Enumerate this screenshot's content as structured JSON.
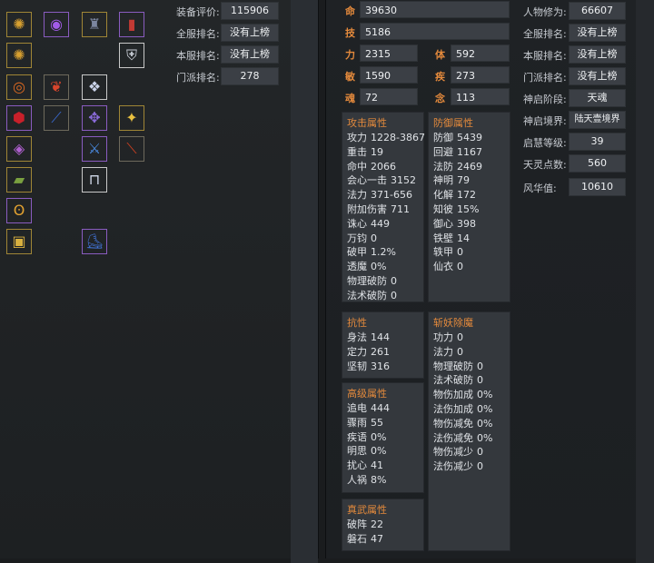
{
  "equipment": {
    "slots": [
      {
        "icon": "sun-medallion-icon",
        "glyph": "✺",
        "color": "#d8a030"
      },
      {
        "icon": "purple-orb-icon",
        "glyph": "◉",
        "color": "#a25be8"
      },
      {
        "icon": "dark-helm-icon",
        "glyph": "♜",
        "color": "#7c86a0"
      },
      {
        "icon": "red-gauntlet-icon",
        "glyph": "▮",
        "color": "#c23a34"
      },
      {
        "icon": "sun-medallion-icon",
        "glyph": "✺",
        "color": "#d8a030"
      },
      {
        "icon": "silver-armor-icon",
        "glyph": "⛨",
        "color": "#c8cdd6"
      },
      {
        "icon": "fire-ring-icon",
        "glyph": "◎",
        "color": "#e06a20"
      },
      {
        "icon": "red-feather-icon",
        "glyph": "❦",
        "color": "#d8452c"
      },
      {
        "icon": "crystal-armor-icon",
        "glyph": "❖",
        "color": "#c9d2e8"
      },
      {
        "icon": "red-bracer-icon",
        "glyph": "⬢",
        "color": "#c8202a"
      },
      {
        "icon": "blue-blade-icon",
        "glyph": "⟋",
        "color": "#3a6ad0"
      },
      {
        "icon": "violet-robe-icon",
        "glyph": "✥",
        "color": "#8a6ad8"
      },
      {
        "icon": "gold-shield-icon",
        "glyph": "✦",
        "color": "#e8c040"
      },
      {
        "icon": "jewel-ring-icon",
        "glyph": "◈",
        "color": "#b060d0"
      },
      {
        "icon": "blue-sword-icon",
        "glyph": "⚔",
        "color": "#4a8ae0"
      },
      {
        "icon": "red-axe-icon",
        "glyph": "⟍",
        "color": "#d04020"
      },
      {
        "icon": "jade-scroll-icon",
        "glyph": "▰",
        "color": "#7aa040"
      },
      {
        "icon": "white-trousers-icon",
        "glyph": "⊓",
        "color": "#d0d8e8"
      },
      {
        "icon": "gold-amulet-icon",
        "glyph": "ʘ",
        "color": "#e0a030"
      },
      {
        "icon": "gold-belt-icon",
        "glyph": "▣",
        "color": "#d8b040"
      },
      {
        "icon": "blue-boots-icon",
        "glyph": "⛸",
        "color": "#4070d0"
      }
    ]
  },
  "rank_summary": {
    "rows": [
      {
        "label": "装备评价:",
        "value": "115906"
      },
      {
        "label": "全服排名:",
        "value": "没有上榜"
      },
      {
        "label": "本服排名:",
        "value": "没有上榜"
      },
      {
        "label": "门派排名:",
        "value": "278"
      }
    ]
  },
  "base_attrs": {
    "ming": {
      "key": "命",
      "value": "39630"
    },
    "ji": {
      "key": "技",
      "value": "5186"
    },
    "li": {
      "key": "力",
      "value": "2315"
    },
    "ti": {
      "key": "体",
      "value": "592"
    },
    "min": {
      "key": "敏",
      "value": "1590"
    },
    "ji2": {
      "key": "疾",
      "value": "273"
    },
    "hun": {
      "key": "魂",
      "value": "72"
    },
    "nian": {
      "key": "念",
      "value": "113"
    }
  },
  "attack_box": {
    "title": "攻击属性",
    "rows": [
      {
        "k": "攻力",
        "v": "1228-3867"
      },
      {
        "k": "重击",
        "v": "19"
      },
      {
        "k": "命中",
        "v": "2066"
      },
      {
        "k": "会心一击",
        "v": "3152"
      },
      {
        "k": "法力",
        "v": "371-656"
      },
      {
        "k": "附加伤害",
        "v": "711"
      },
      {
        "k": "诛心",
        "v": "449"
      },
      {
        "k": "万钧",
        "v": "0"
      },
      {
        "k": "破甲",
        "v": "1.2%"
      },
      {
        "k": "透魔",
        "v": "0%"
      },
      {
        "k": "物理破防",
        "v": "0"
      },
      {
        "k": "法术破防",
        "v": "0"
      }
    ]
  },
  "defense_box": {
    "title": "防御属性",
    "rows": [
      {
        "k": "防御",
        "v": "5439"
      },
      {
        "k": "回避",
        "v": "1167"
      },
      {
        "k": "法防",
        "v": "2469"
      },
      {
        "k": "神明",
        "v": "79"
      },
      {
        "k": "化解",
        "v": "172"
      },
      {
        "k": "知彼",
        "v": "15%"
      },
      {
        "k": "御心",
        "v": "398"
      },
      {
        "k": "铁壁",
        "v": "14"
      },
      {
        "k": "轶甲",
        "v": "0"
      },
      {
        "k": "仙衣",
        "v": "0"
      }
    ]
  },
  "resist_box": {
    "title": "抗性",
    "rows": [
      {
        "k": "身法",
        "v": "144"
      },
      {
        "k": "定力",
        "v": "261"
      },
      {
        "k": "坚韧",
        "v": "316"
      }
    ]
  },
  "advanced_box": {
    "title": "高级属性",
    "rows": [
      {
        "k": "追电",
        "v": "444"
      },
      {
        "k": "骤雨",
        "v": "55"
      },
      {
        "k": "疾语",
        "v": "0%"
      },
      {
        "k": "明思",
        "v": "0%"
      },
      {
        "k": "扰心",
        "v": "41"
      },
      {
        "k": "人祸",
        "v": "8%"
      }
    ]
  },
  "zhenwu_box": {
    "title": "真武属性",
    "rows": [
      {
        "k": "破阵",
        "v": "22"
      },
      {
        "k": "磐石",
        "v": "47"
      }
    ]
  },
  "demon_box": {
    "title": "斩妖除魔",
    "rows": [
      {
        "k": "功力",
        "v": "0"
      },
      {
        "k": "法力",
        "v": "0"
      },
      {
        "k": "物理破防",
        "v": "0"
      },
      {
        "k": "法术破防",
        "v": "0"
      },
      {
        "k": "物伤加成",
        "v": "0%"
      },
      {
        "k": "法伤加成",
        "v": "0%"
      },
      {
        "k": "物伤减免",
        "v": "0%"
      },
      {
        "k": "法伤减免",
        "v": "0%"
      },
      {
        "k": "物伤减少",
        "v": "0"
      },
      {
        "k": "法伤减少",
        "v": "0"
      }
    ]
  },
  "char_info": {
    "rows": [
      {
        "label": "人物修为:",
        "value": "66607"
      },
      {
        "label": "全服排名:",
        "value": "没有上榜"
      },
      {
        "label": "本服排名:",
        "value": "没有上榜"
      },
      {
        "label": "门派排名:",
        "value": "没有上榜"
      },
      {
        "label": "神启阶段:",
        "value": "天魂"
      },
      {
        "label": "神启境界:",
        "value": "陆天壹境界"
      },
      {
        "label": "启慧等级:",
        "value": "39"
      },
      {
        "label": "天灵点数:",
        "value": "560"
      },
      {
        "label": "风华值:",
        "value": "10610"
      }
    ]
  },
  "colors": {
    "accent": "#e48a3c",
    "value_bg": "#3b3f45",
    "box_bg": "#34383d",
    "slot_gold": "#a08636",
    "slot_purple": "#8a5cc0"
  }
}
